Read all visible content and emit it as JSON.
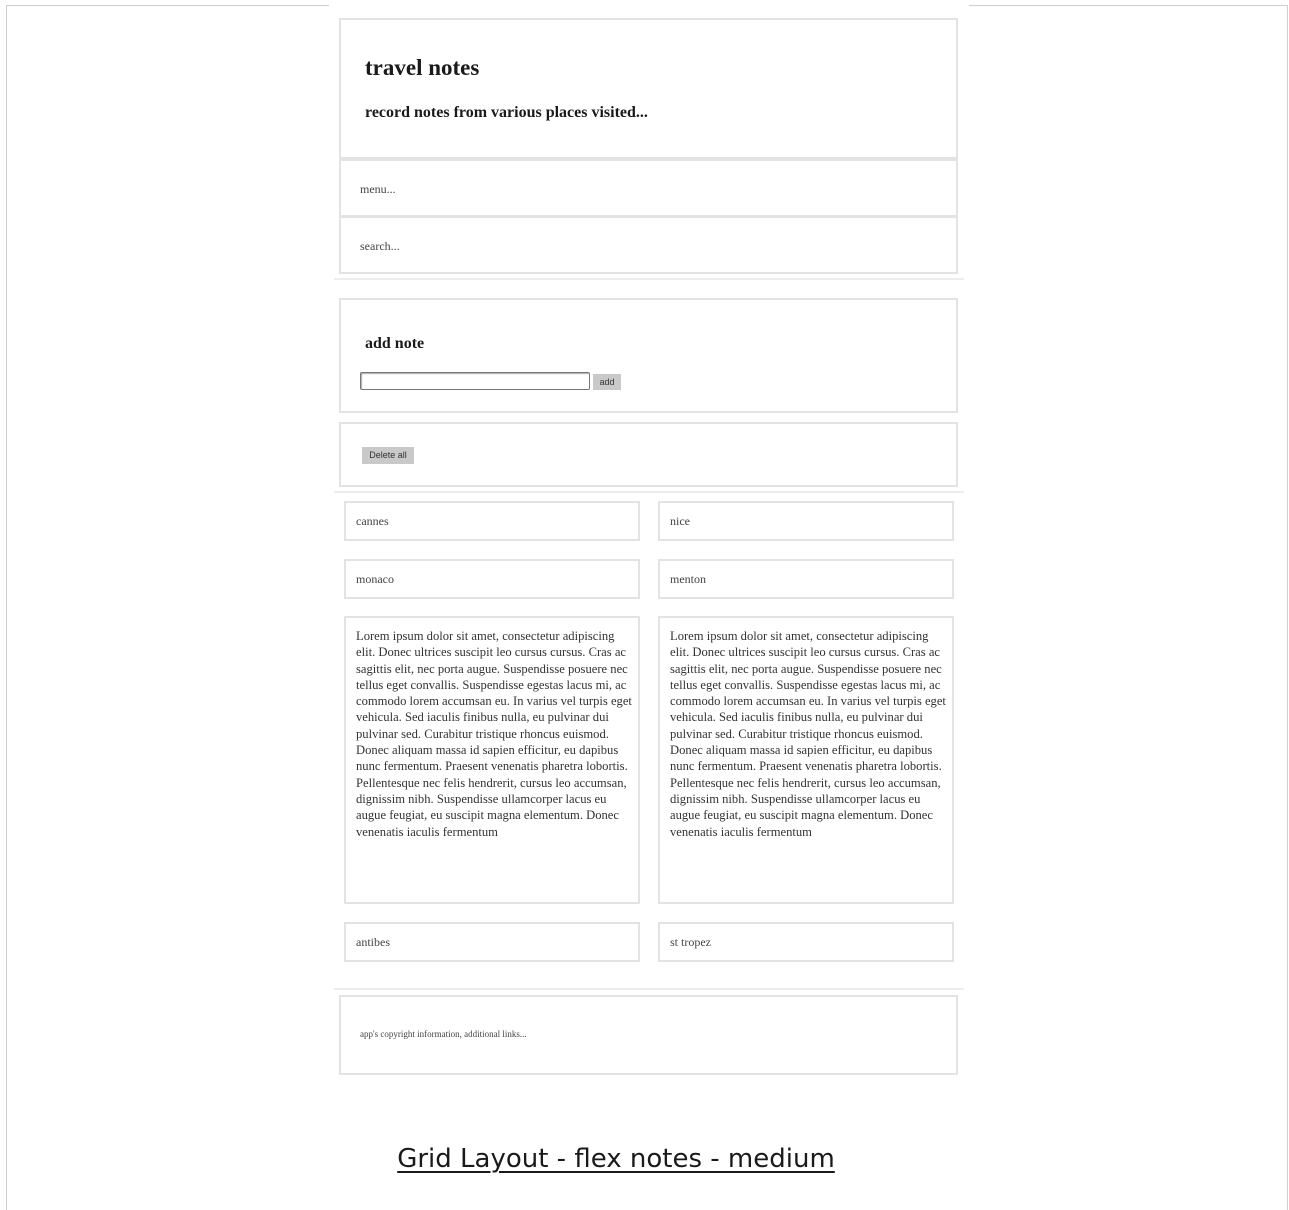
{
  "app": {
    "title": "travel notes",
    "subtitle": "record notes from various places visited..."
  },
  "nav": {
    "menu_text": "menu...",
    "search_text": "search..."
  },
  "add_note": {
    "heading": "add note",
    "input_value": "",
    "add_label": "add"
  },
  "actions": {
    "delete_all_label": "Delete all"
  },
  "notes": [
    {
      "text": "cannes"
    },
    {
      "text": "nice"
    },
    {
      "text": "monaco"
    },
    {
      "text": "menton"
    },
    {
      "text": "Lorem ipsum dolor sit amet, consectetur adipiscing elit. Donec ultrices suscipit leo cursus cursus. Cras ac sagittis elit, nec porta augue. Suspendisse posuere nec tellus eget convallis. Suspendisse egestas lacus mi, ac commodo lorem accumsan eu. In varius vel turpis eget vehicula. Sed iaculis finibus nulla, eu pulvinar dui pulvinar sed. Curabitur tristique rhoncus euismod. Donec aliquam massa id sapien efficitur, eu dapibus nunc fermentum. Praesent venenatis pharetra lobortis. Pellentesque nec felis hendrerit, cursus leo accumsan, dignissim nibh. Suspendisse ullamcorper lacus eu augue feugiat, eu suscipit magna elementum. Donec venenatis iaculis fermentum"
    },
    {
      "text": "Lorem ipsum dolor sit amet, consectetur adipiscing elit. Donec ultrices suscipit leo cursus cursus. Cras ac sagittis elit, nec porta augue. Suspendisse posuere nec tellus eget convallis. Suspendisse egestas lacus mi, ac commodo lorem accumsan eu. In varius vel turpis eget vehicula. Sed iaculis finibus nulla, eu pulvinar dui pulvinar sed. Curabitur tristique rhoncus euismod. Donec aliquam massa id sapien efficitur, eu dapibus nunc fermentum. Praesent venenatis pharetra lobortis. Pellentesque nec felis hendrerit, cursus leo accumsan, dignissim nibh. Suspendisse ullamcorper lacus eu augue feugiat, eu suscipit magna elementum. Donec venenatis iaculis fermentum"
    },
    {
      "text": "antibes"
    },
    {
      "text": "st tropez"
    }
  ],
  "footer": {
    "text": "app's copyright information, additional links..."
  },
  "caption": {
    "text": "Grid Layout - flex notes - medium"
  },
  "colors": {
    "border": "#e3e3e3",
    "button_bg": "#c9c9c9",
    "text": "#222222"
  }
}
